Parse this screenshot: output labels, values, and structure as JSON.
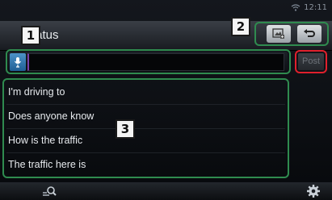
{
  "status_bar": {
    "clock": "12:11",
    "wifi_icon": "wifi-icon"
  },
  "header": {
    "title": "tatus",
    "buttons": [
      {
        "icon": "image-attach-icon"
      },
      {
        "icon": "back-icon"
      }
    ]
  },
  "callouts": {
    "c1": "1",
    "c2": "2",
    "c3": "3"
  },
  "compose": {
    "mic_icon": "microphone-icon",
    "value": "",
    "post_label": "Post"
  },
  "templates": [
    "I'm driving to",
    "Does anyone know",
    "How is the traffic",
    "The traffic here is"
  ],
  "bottom_bar": {
    "left_icon": "search-list-icon",
    "right_icon": "gear-icon"
  },
  "colors": {
    "callout_frame_green": "#2f8b4f",
    "post_frame_red": "#e0202c",
    "mic_button_blue": "#2f76ad"
  }
}
